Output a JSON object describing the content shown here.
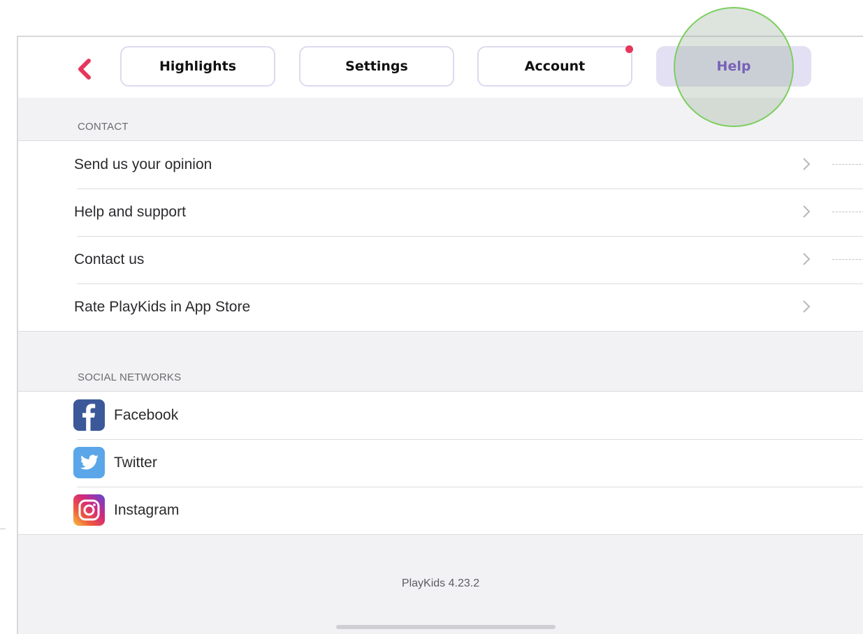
{
  "nav": {
    "tabs": [
      {
        "label": "Highlights",
        "active": false,
        "notification": false
      },
      {
        "label": "Settings",
        "active": false,
        "notification": false
      },
      {
        "label": "Account",
        "active": false,
        "notification": true
      },
      {
        "label": "Help",
        "active": true,
        "notification": false
      }
    ],
    "back_icon": "chevron-left-icon",
    "accent_color": "#e6365c",
    "active_tab_color": "#6a3fc8"
  },
  "contact": {
    "section_title": "CONTACT",
    "items": [
      {
        "label": "Send us your opinion"
      },
      {
        "label": "Help and support"
      },
      {
        "label": "Contact us"
      },
      {
        "label": "Rate PlayKids in App Store"
      }
    ]
  },
  "social": {
    "section_title": "SOCIAL NETWORKS",
    "items": [
      {
        "label": "Facebook",
        "icon": "facebook-icon"
      },
      {
        "label": "Twitter",
        "icon": "twitter-icon"
      },
      {
        "label": "Instagram",
        "icon": "instagram-icon"
      }
    ]
  },
  "footer": {
    "version": "PlayKids 4.23.2"
  }
}
